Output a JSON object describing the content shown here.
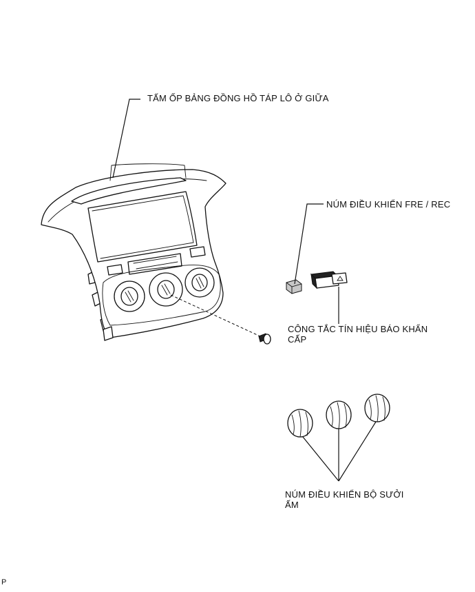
{
  "labels": {
    "center_panel": "TẤM ỐP BẢNG ĐỒNG HỒ TÁP LÔ Ở GIỮA",
    "fre_rec_knob": "NÚM ĐIỀU KHIỂN FRE / REC",
    "hazard_switch": "CÔNG TẮC TÍN HIỆU BÁO KHẨN\nCẤP",
    "heater_knobs": "NÚM ĐIỀU KHIỂN BỘ SƯỞI\nẤM"
  },
  "corner_mark": "P"
}
